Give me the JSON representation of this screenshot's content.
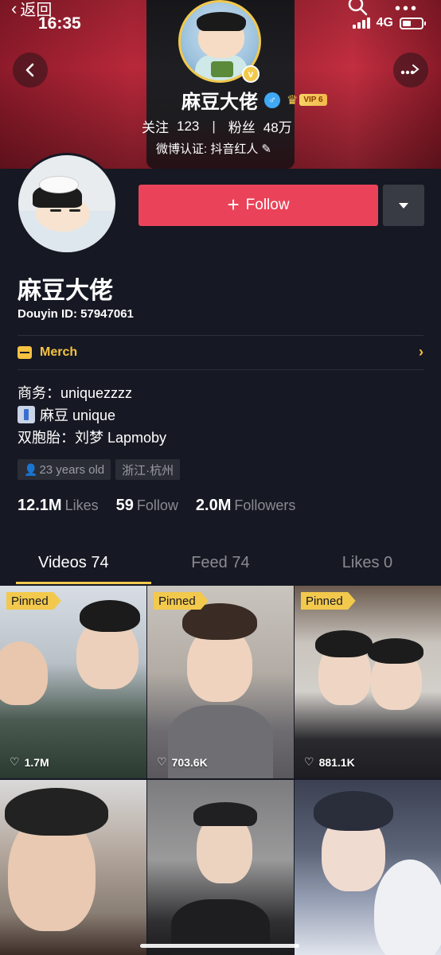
{
  "status": {
    "back_label": "返回",
    "time": "16:35",
    "network": "4G"
  },
  "banner": {
    "name": "麻豆大佬",
    "gender": "♂",
    "vip": "VIP 6",
    "following_label": "关注",
    "following_count": "123",
    "separator": "|",
    "fans_label": "粉丝",
    "fans_count": "48万",
    "verification": "微博认证: 抖音红人"
  },
  "profile": {
    "follow_label": "Follow",
    "name": "麻豆大佬",
    "douyin_id": "Douyin ID: 57947061",
    "merch_label": "Merch",
    "bio_line1": "商务：uniquezzzz",
    "bio_line2": "麻豆 unique",
    "bio_line3": "双胞胎：刘梦 Lapmoby",
    "tag_age": "23 years old",
    "tag_location": "浙江·杭州"
  },
  "stats": [
    {
      "num": "12.1M",
      "label": "Likes"
    },
    {
      "num": "59",
      "label": "Follow"
    },
    {
      "num": "2.0M",
      "label": "Followers"
    }
  ],
  "tabs": [
    {
      "label": "Videos 74",
      "active": true
    },
    {
      "label": "Feed 74",
      "active": false
    },
    {
      "label": "Likes 0",
      "active": false
    }
  ],
  "videos": [
    {
      "pinned": "Pinned",
      "likes": "1.7M"
    },
    {
      "pinned": "Pinned",
      "likes": "703.6K"
    },
    {
      "pinned": "Pinned",
      "likes": "881.1K"
    },
    {
      "pinned": "",
      "likes": ""
    },
    {
      "pinned": "",
      "likes": ""
    },
    {
      "pinned": "",
      "likes": ""
    }
  ],
  "colors": {
    "accent": "#ea4359",
    "gold": "#f2c94c",
    "background": "#161823"
  }
}
